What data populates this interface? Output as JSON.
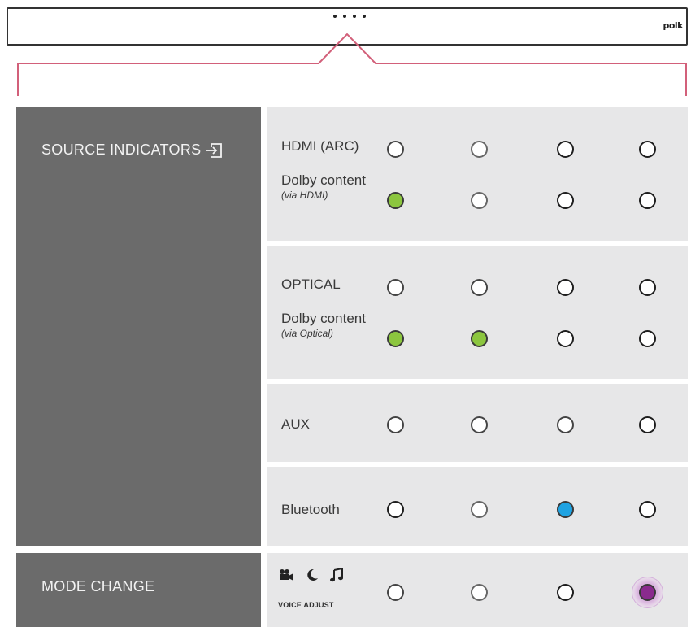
{
  "soundbar": {
    "brand": "polk",
    "led_count": 4
  },
  "source_indicators": {
    "label": "SOURCE INDICATORS",
    "icon": "input-source-icon"
  },
  "mode_change": {
    "label": "MODE CHANGE",
    "icons": [
      "movie-camera-icon",
      "night-moon-icon",
      "music-note-icon"
    ],
    "voice_adjust_label": "VOICE ADJUST"
  },
  "rows": [
    {
      "label": "HDMI (ARC)",
      "indicators": [
        "off",
        "off",
        "off",
        "off"
      ]
    },
    {
      "label": "Dolby content",
      "sublabel": "(via HDMI)",
      "indicators": [
        "green",
        "off",
        "off",
        "off"
      ]
    },
    {
      "label": "OPTICAL",
      "indicators": [
        "off",
        "off",
        "off",
        "off"
      ]
    },
    {
      "label": "Dolby content",
      "sublabel": "(via Optical)",
      "indicators": [
        "green",
        "green",
        "off",
        "off"
      ]
    },
    {
      "label": "AUX",
      "indicators": [
        "off",
        "off",
        "off",
        "off"
      ]
    },
    {
      "label": "Bluetooth",
      "indicators": [
        "off",
        "off",
        "blue",
        "off"
      ]
    },
    {
      "label": "",
      "indicators": [
        "off",
        "off",
        "off",
        "purple"
      ]
    }
  ],
  "colors": {
    "green": "#8cc63f",
    "blue": "#1fa3e2",
    "purple": "#8a2a8e",
    "callout": "#d2607a",
    "label_bg": "#6b6b6b",
    "row_bg": "#e7e7e8"
  }
}
